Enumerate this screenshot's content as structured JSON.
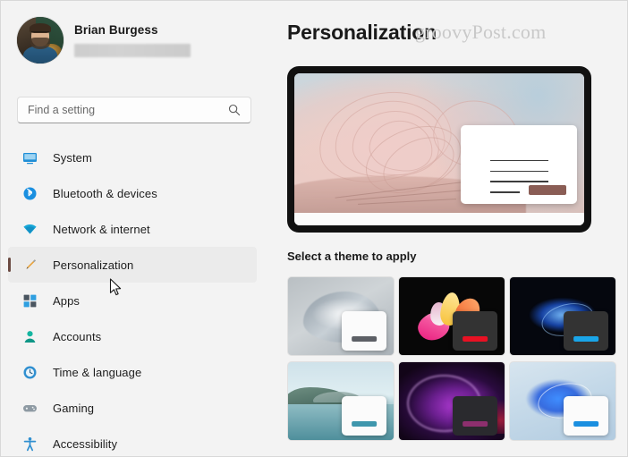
{
  "sidebar": {
    "profile": {
      "name": "Brian Burgess",
      "email_redacted": "",
      "avatar_icon": "user-photo-avatar"
    },
    "search": {
      "placeholder": "Find a setting",
      "icon": "search-icon"
    },
    "items": [
      {
        "label": "System",
        "icon": "monitor-icon",
        "selected": false
      },
      {
        "label": "Bluetooth & devices",
        "icon": "bluetooth-icon",
        "selected": false
      },
      {
        "label": "Network & internet",
        "icon": "wifi-icon",
        "selected": false
      },
      {
        "label": "Personalization",
        "icon": "paintbrush-icon",
        "selected": true
      },
      {
        "label": "Apps",
        "icon": "apps-grid-icon",
        "selected": false
      },
      {
        "label": "Accounts",
        "icon": "person-icon",
        "selected": false
      },
      {
        "label": "Time & language",
        "icon": "clock-icon",
        "selected": false
      },
      {
        "label": "Gaming",
        "icon": "gamepad-icon",
        "selected": false
      },
      {
        "label": "Accessibility",
        "icon": "accessibility-icon",
        "selected": false
      }
    ]
  },
  "main": {
    "title": "Personalization",
    "watermark": "groovyPost.com",
    "preview": {
      "wallpaper_name": "windows-11-bloom-rose",
      "accent_color": "#8a5d55"
    },
    "section_label": "Select a theme to apply",
    "themes": [
      {
        "name": "bloom-light-gray",
        "wallpaper": "tw-gray",
        "mock": "light",
        "accent": "#5d6066"
      },
      {
        "name": "flower-dark",
        "wallpaper": "tw-dark-flower",
        "mock": "dark",
        "accent": "#e81123"
      },
      {
        "name": "bloom-blue-dark",
        "wallpaper": "tw-blue-dark",
        "mock": "dark",
        "accent": "#1aa5e8"
      },
      {
        "name": "lake-landscape",
        "wallpaper": "tw-lake",
        "mock": "light",
        "accent": "#3f97ad"
      },
      {
        "name": "glow-purple",
        "wallpaper": "tw-purple",
        "mock": "dark2",
        "accent": "#8d2f6e"
      },
      {
        "name": "bloom-blue-light",
        "wallpaper": "tw-blue-light",
        "mock": "light",
        "accent": "#1a8fe0"
      }
    ]
  },
  "colors": {
    "window_bg": "#f3f3f3",
    "selected_nav_bg": "#ebebeb",
    "selected_accent_bar": "#6b4a42",
    "text_primary": "#1a1a1a",
    "text_secondary": "#6a6a6a",
    "watermark": "#c9c9c9"
  }
}
